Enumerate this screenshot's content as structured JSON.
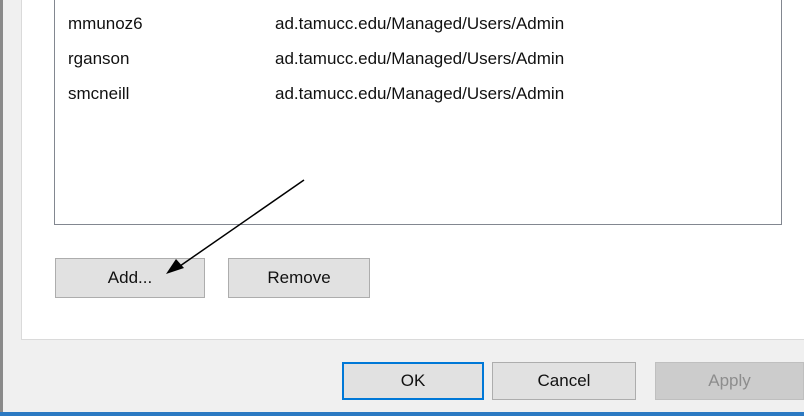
{
  "users": [
    {
      "name": "mmunoz6",
      "path": "ad.tamucc.edu/Managed/Users/Admin"
    },
    {
      "name": "rganson",
      "path": "ad.tamucc.edu/Managed/Users/Admin"
    },
    {
      "name": "smcneill",
      "path": "ad.tamucc.edu/Managed/Users/Admin"
    }
  ],
  "buttons": {
    "add": "Add...",
    "remove": "Remove",
    "ok": "OK",
    "cancel": "Cancel",
    "apply": "Apply"
  },
  "colors": {
    "accent": "#0078d7",
    "annotation_arrow": "#000000",
    "focus_bar": "#2b79c2"
  }
}
